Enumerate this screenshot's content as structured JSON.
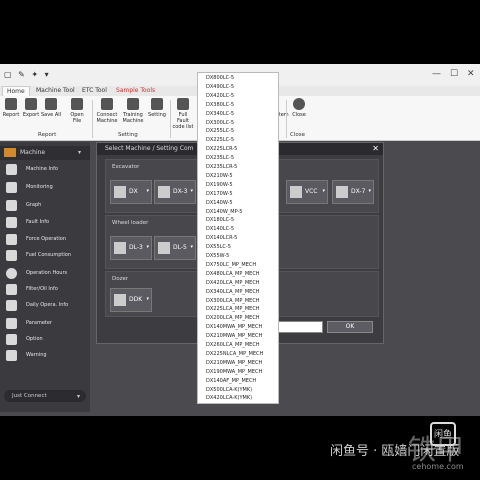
{
  "title_bar": {
    "quick_access": "▢ ✎ ✦ ▾",
    "min": "—",
    "max": "☐",
    "close": "✕"
  },
  "tabs": [
    {
      "label": "Home"
    },
    {
      "label": "Machine Tool"
    },
    {
      "label": "ETC Tool"
    },
    {
      "label": "Sample Tools"
    }
  ],
  "ribbon": {
    "report": "Report",
    "export": "Export",
    "save_all": "Save All",
    "open_file": "Open File",
    "connect_machine": "Connect Machine",
    "training_machine": "Training Machine",
    "setting": "Setting",
    "full_fault_code_list": "Full Fault code list",
    "item": "item",
    "close": "Close",
    "group_report": "Report",
    "group_setting": "Setting",
    "group_close": "Close"
  },
  "sidebar": {
    "header": "Machine",
    "items": [
      {
        "label": "Machine Info"
      },
      {
        "label": "Monitoring"
      },
      {
        "label": "Graph"
      },
      {
        "label": "Fault Info"
      },
      {
        "label": "Force Operation"
      },
      {
        "label": "Fuel Consumption"
      },
      {
        "label": "Operation Hours"
      },
      {
        "label": "Filter/Oil Info"
      },
      {
        "label": "Daily Opera. Info"
      },
      {
        "label": "Parameter"
      },
      {
        "label": "Option"
      },
      {
        "label": "Warning"
      }
    ],
    "bottom": "Just Connect"
  },
  "dialog": {
    "title": "Select Machine / Setting Com",
    "close": "✕",
    "excavator": {
      "label": "Excavator",
      "buttons": [
        {
          "label": "DX"
        },
        {
          "label": "DX-3"
        },
        {
          "label": "VCC"
        },
        {
          "label": "DX-7"
        }
      ]
    },
    "wheel_loader": {
      "label": "Wheel loader",
      "buttons": [
        {
          "label": "DL-3"
        },
        {
          "label": "DL-5"
        }
      ]
    },
    "dozer": {
      "label": "Dozer",
      "buttons": [
        {
          "label": "DDK"
        }
      ]
    },
    "ok": "OK",
    "arrow": "▾"
  },
  "dropdown": [
    "DX800LC-5",
    "DX490LC-5",
    "DX420LC-5",
    "DX380LC-5",
    "DX340LC-5",
    "DX300LC-5",
    "DX255LC-5",
    "DX225LC-5",
    "DX225LCR-5",
    "DX235LC-5",
    "DX235LCR-5",
    "DX210W-5",
    "DX190W-5",
    "DX170W-5",
    "DX140W-5",
    "DX140W_MP-5",
    "DX180LC-5",
    "DX140LC-5",
    "DX140LCR-5",
    "DX55LC-5",
    "DX55W-5",
    "DX750LC_MP_MECH",
    "DX480LCA_MP_MECH",
    "DX420LCA_MP_MECH",
    "DX340LCA_MP_MECH",
    "DX300LCA_MP_MECH",
    "DX225LCA_MP_MECH",
    "DX200LCA_MP_MECH",
    "DX140MWA_MP_MECH",
    "DX210MWA_MP_MECH",
    "DX260LCA_MP_MECH",
    "DX225NLCA_MP_MECH",
    "DX210MWA_MP_MECH",
    "DX190MWA_MP_MECH",
    "DX140AF_MP_MECH",
    "DX500LCA-K(YMK)",
    "DX420LCA-K(YMK)"
  ],
  "watermark": {
    "text": "闲鱼号 · 瓯嫱门闲置版",
    "logo": "闲鱼",
    "brand": "铁甲",
    "site": "cehome.com"
  }
}
